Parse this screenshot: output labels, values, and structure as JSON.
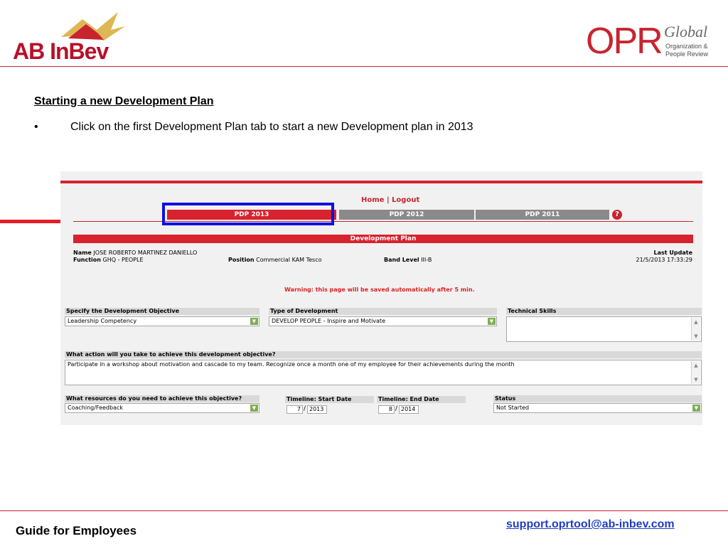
{
  "brand": {
    "left_logo": "AB InBev",
    "right_logo_main": "OPR",
    "right_logo_global": "Global",
    "right_logo_sub1": "Organization &",
    "right_logo_sub2": "People Review"
  },
  "slide": {
    "title": "Starting a new Development Plan",
    "bullet_marker": "•",
    "bullet_text": "Click on the first Development Plan tab to start a new Development plan in 2013"
  },
  "app": {
    "menu": "Home | Logout",
    "tabs": [
      {
        "label": "PDP 2013",
        "active": true
      },
      {
        "label": "PDP 2012",
        "active": false
      },
      {
        "label": "PDP 2011",
        "active": false
      }
    ],
    "help_icon": "?",
    "section_title": "Development Plan",
    "info": {
      "name_label": "Name",
      "name_value": "JOSE ROBERTO MARTINEZ DANIELLO",
      "function_label": "Function",
      "function_value": "GHQ - PEOPLE",
      "position_label": "Position",
      "position_value": "Commercial KAM Tesco",
      "band_label": "Band Level",
      "band_value": "III-B",
      "last_update_label": "Last Update",
      "last_update_value": "21/5/2013 17:33:29"
    },
    "warning": "Warning: this page will be saved automatically after 5 min.",
    "fields": {
      "objective_label": "Specify the Development Objective",
      "objective_value": "Leadership Competency",
      "type_label": "Type of Development",
      "type_value": "DEVELOP PEOPLE - Inspire and Motivate",
      "technical_label": "Technical Skills",
      "technical_value": "",
      "action_label": "What action will you take to achieve this development objective?",
      "action_value": "Participate in a workshop about motivation and cascade to my team. Recognize once a month one of my employee for their achievements during the month",
      "resources_label": "What resources do you need to achieve this objective?",
      "resources_value": "Coaching/Feedback",
      "start_label": "Timeline: Start Date",
      "start_month": "7",
      "start_year": "2013",
      "end_label": "Timeline: End Date",
      "end_month": "8",
      "end_year": "2014",
      "status_label": "Status",
      "status_value": "Not Started",
      "date_separator": "/"
    }
  },
  "footer": {
    "left": "Guide for Employees",
    "right": "support.oprtool@ab-inbev.com"
  },
  "colors": {
    "brand_red": "#c8242f",
    "highlight_blue": "#1010e0",
    "link_blue": "#1f3cc4",
    "dropdown_green": "#7fae52"
  }
}
